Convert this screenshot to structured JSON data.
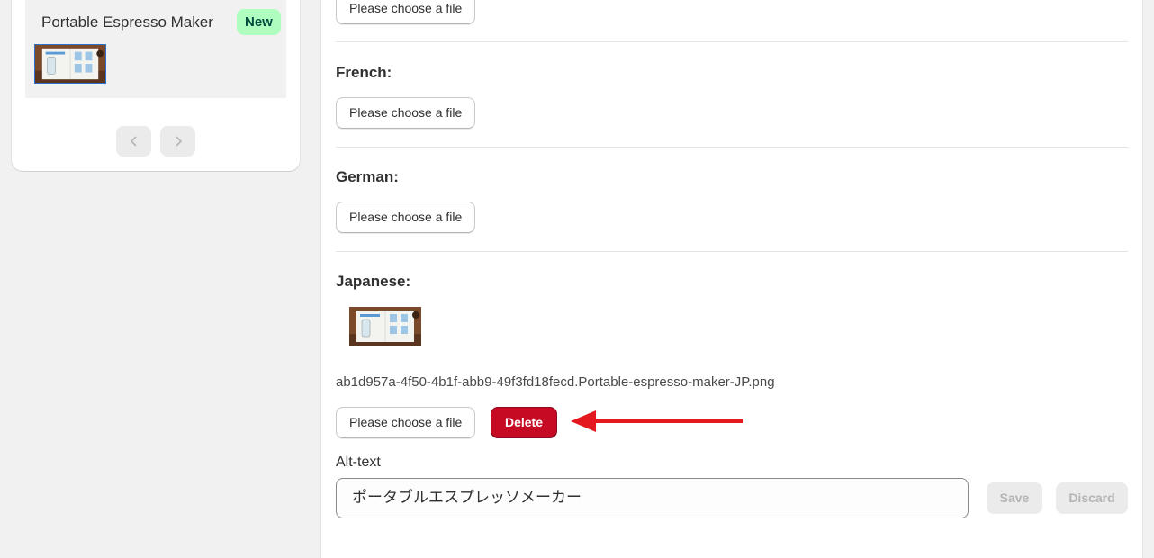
{
  "product_card": {
    "title": "Portable Espresso Maker",
    "badge": "New",
    "thumbnail_icon": "product-image-thumbnail",
    "prev_icon": "chevron-left-icon",
    "next_icon": "chevron-right-icon"
  },
  "translations": {
    "choose_file_label": "Please choose a file",
    "french_label": "French:",
    "german_label": "German:",
    "japanese_label": "Japanese:",
    "japanese_filename": "ab1d957a-4f50-4b1f-abb9-49f3fd18fecd.Portable-espresso-maker-JP.png",
    "delete_label": "Delete"
  },
  "alt_text": {
    "label": "Alt-text",
    "value": "ポータブルエスプレッソメーカー",
    "save_label": "Save",
    "discard_label": "Discard"
  },
  "colors": {
    "badge_bg": "#affebf",
    "delete_bg": "#c70a24",
    "annotation_arrow": "#e3191f"
  }
}
